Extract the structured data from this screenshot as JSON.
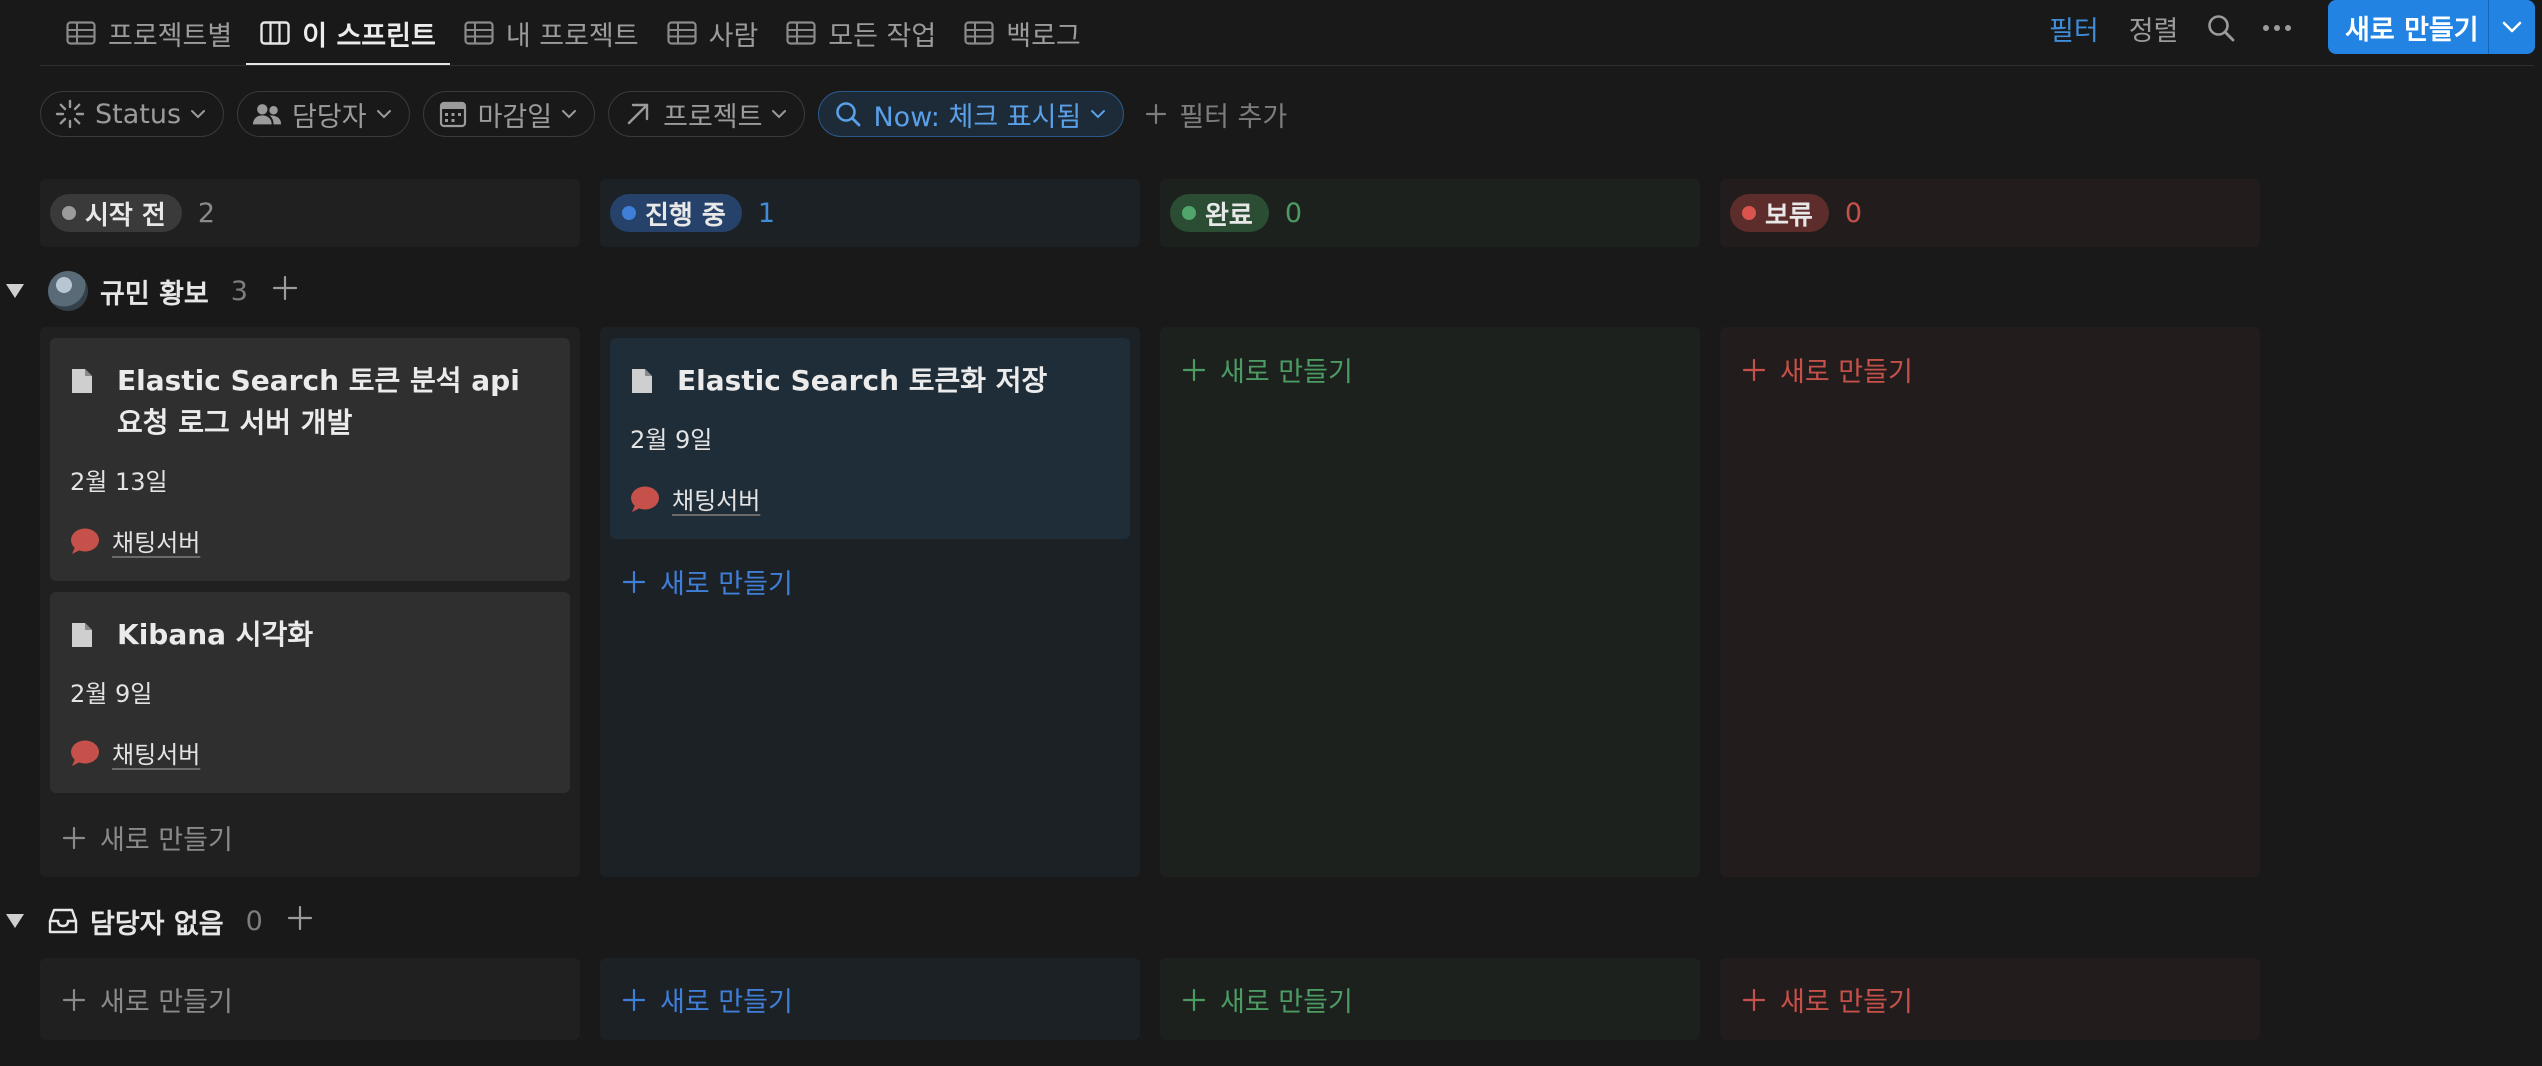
{
  "tabs": [
    {
      "label": "프로젝트별",
      "icon": "table-icon",
      "active": false
    },
    {
      "label": "이 스프린트",
      "icon": "board-icon",
      "active": true
    },
    {
      "label": "내 프로젝트",
      "icon": "table-icon",
      "active": false
    },
    {
      "label": "사람",
      "icon": "table-icon",
      "active": false
    },
    {
      "label": "모든 작업",
      "icon": "table-icon",
      "active": false
    },
    {
      "label": "백로그",
      "icon": "table-icon",
      "active": false
    }
  ],
  "toolbar": {
    "filter_label": "필터",
    "sort_label": "정렬",
    "new_label": "새로 만들기"
  },
  "filters": [
    {
      "label": "Status",
      "icon": "status-spinner-icon"
    },
    {
      "label": "담당자",
      "icon": "people-icon"
    },
    {
      "label": "마감일",
      "icon": "calendar-icon"
    },
    {
      "label": "프로젝트",
      "icon": "relation-arrow-icon"
    },
    {
      "label": "Now: 체크 표시됨",
      "icon": "search-icon",
      "active": true
    }
  ],
  "add_filter_label": "필터 추가",
  "columns": [
    {
      "label": "시작 전",
      "count": "2",
      "dot": "#9b9b9b"
    },
    {
      "label": "진행 중",
      "count": "1",
      "dot": "#3f7fd8"
    },
    {
      "label": "완료",
      "count": "0",
      "dot": "#4fa56a"
    },
    {
      "label": "보류",
      "count": "0",
      "dot": "#d9534f"
    }
  ],
  "colors": {
    "blue": "#3f8cd8",
    "green": "#4c9b63",
    "red": "#c6504a",
    "gray": "#7d7d7d"
  },
  "groups": [
    {
      "name": "규민 황보",
      "count": "3",
      "cards": {
        "todo": [
          {
            "title": "Elastic Search 토큰 분석 api 요청 로그 서버 개발",
            "date": "2월 13일",
            "project": "채팅서버"
          },
          {
            "title": "Kibana 시각화",
            "date": "2월 9일",
            "project": "채팅서버"
          }
        ],
        "doing": [
          {
            "title": "Elastic Search 토큰화 저장",
            "date": "2월 9일",
            "project": "채팅서버"
          }
        ]
      }
    },
    {
      "name": "담당자 없음",
      "count": "0"
    }
  ],
  "new_item_label": "새로 만들기"
}
